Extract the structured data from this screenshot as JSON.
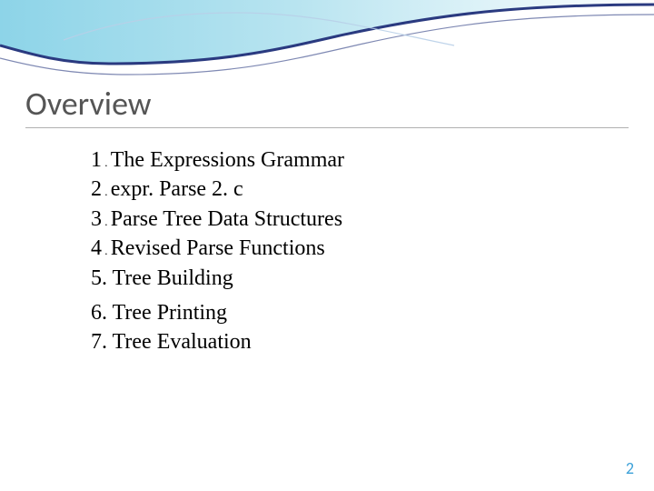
{
  "title": "Overview",
  "items": [
    {
      "num": "1",
      "text": "The Expressions Grammar",
      "small_dot": true
    },
    {
      "num": "2",
      "text": "expr. Parse 2. c",
      "small_dot": true
    },
    {
      "num": "3",
      "text": "Parse Tree Data Structures",
      "small_dot": true
    },
    {
      "num": "4",
      "text": "Revised Parse Functions",
      "small_dot": true
    },
    {
      "num": "5",
      "text": "Tree Building",
      "small_dot": false
    },
    {
      "num": "6",
      "text": "Tree Printing",
      "small_dot": false
    },
    {
      "num": "7",
      "text": "Tree Evaluation",
      "small_dot": false
    }
  ],
  "page_number": "2"
}
